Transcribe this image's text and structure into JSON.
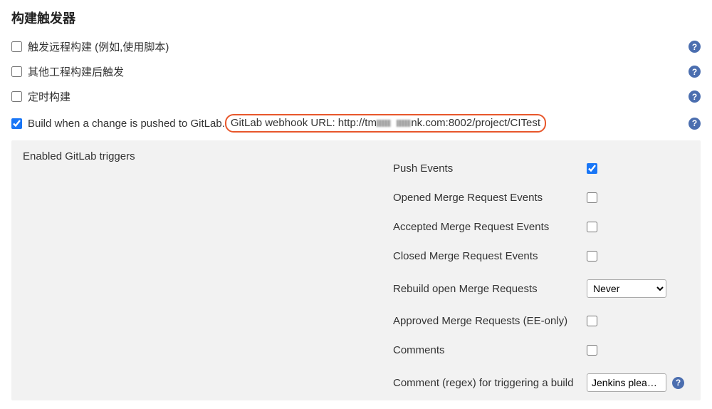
{
  "section": {
    "title": "构建触发器"
  },
  "triggers": {
    "remote": {
      "label": "触发远程构建 (例如,使用脚本)",
      "checked": false
    },
    "afterOther": {
      "label": "其他工程构建后触发",
      "checked": false
    },
    "schedule": {
      "label": "定时构建",
      "checked": false
    },
    "gitlab": {
      "label_pre": "Build when a change is pushed to GitLab. ",
      "label_webhook_prefix": "GitLab webhook URL: http://tm",
      "label_webhook_suffix": "nk.com:8002/project/CITest",
      "checked": true
    }
  },
  "gitlabTriggers": {
    "header": "Enabled GitLab triggers",
    "pushEvents": {
      "label": "Push Events",
      "checked": true
    },
    "openedMR": {
      "label": "Opened Merge Request Events",
      "checked": false
    },
    "acceptedMR": {
      "label": "Accepted Merge Request Events",
      "checked": false
    },
    "closedMR": {
      "label": "Closed Merge Request Events",
      "checked": false
    },
    "rebuildOpenMR": {
      "label": "Rebuild open Merge Requests",
      "selected": "Never"
    },
    "approvedMR": {
      "label": "Approved Merge Requests (EE-only)",
      "checked": false
    },
    "comments": {
      "label": "Comments",
      "checked": false
    },
    "commentRegex": {
      "label": "Comment (regex) for triggering a build",
      "value": "Jenkins please r"
    }
  },
  "icons": {
    "help": "?"
  }
}
